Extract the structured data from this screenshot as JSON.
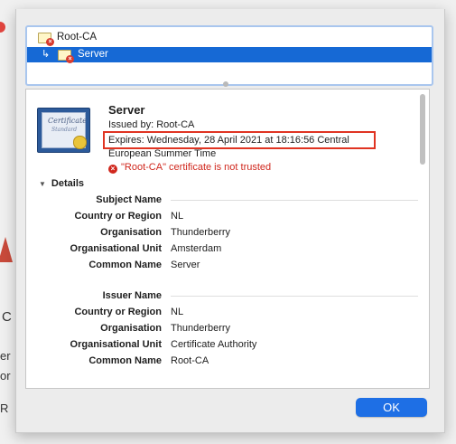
{
  "background": {
    "fragments": [
      "C",
      "er",
      "or",
      "R"
    ]
  },
  "chain": {
    "items": [
      {
        "label": "Root-CA",
        "icon": "certificate-untrusted-icon",
        "selected": false
      },
      {
        "label": "Server",
        "icon": "certificate-untrusted-icon",
        "selected": true,
        "indent_glyph": "↳"
      }
    ]
  },
  "certificate": {
    "image_line1": "Certificate",
    "image_line2": "Standard",
    "name": "Server",
    "issued_by": "Issued by: Root-CA",
    "expires": "Expires: Wednesday, 28 April 2021 at 18:16:56 Central",
    "expires_cont": "European Summer Time",
    "trust_status": "\"Root-CA\" certificate is not trusted",
    "trust_icon": "error-x-icon"
  },
  "details": {
    "toggle_label": "Details",
    "subject": {
      "heading": "Subject Name",
      "rows": [
        {
          "key": "Country or Region",
          "value": "NL"
        },
        {
          "key": "Organisation",
          "value": "Thunderberry"
        },
        {
          "key": "Organisational Unit",
          "value": "Amsterdam"
        },
        {
          "key": "Common Name",
          "value": "Server"
        }
      ]
    },
    "issuer": {
      "heading": "Issuer Name",
      "rows": [
        {
          "key": "Country or Region",
          "value": "NL"
        },
        {
          "key": "Organisation",
          "value": "Thunderberry"
        },
        {
          "key": "Organisational Unit",
          "value": "Certificate Authority"
        },
        {
          "key": "Common Name",
          "value": "Root-CA"
        }
      ]
    }
  },
  "buttons": {
    "ok": "OK"
  },
  "colors": {
    "selection": "#1669d5",
    "error": "#d0271d",
    "highlight_box": "#e03422",
    "ok_button": "#1e6fe5"
  }
}
